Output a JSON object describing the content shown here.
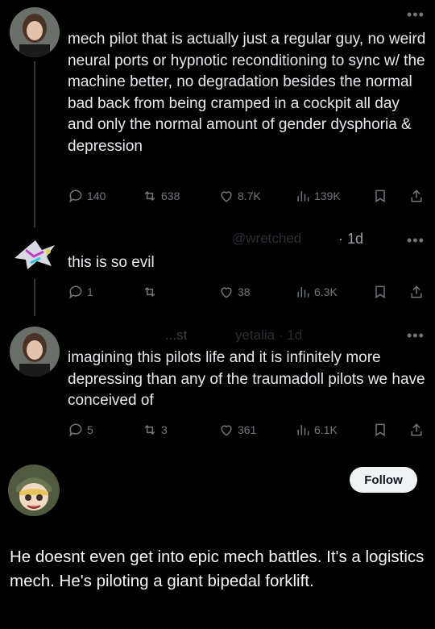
{
  "tweets": [
    {
      "text": "mech pilot that is actually just a regular guy, no weird neural ports or hypnotic reconditioning to sync w/ the machine better, no degradation besides the normal bad back from being cramped in a cockpit all day and only the normal amount of gender dysphoria & depression",
      "more": "•••",
      "replies": "140",
      "reposts": "638",
      "likes": "8.7K",
      "views": "139K"
    },
    {
      "handle": "@wretched",
      "time": "· 1d",
      "text": "this is so evil",
      "more": "•••",
      "replies": "1",
      "reposts": "",
      "likes": "38",
      "views": "6.3K"
    },
    {
      "name_fragment": "...st",
      "handle": "yetalia · 1d",
      "text": "imagining this pilots life and it is infinitely more depressing than any of the traumadoll pilots we have conceived of",
      "more": "•••",
      "replies": "5",
      "reposts": "3",
      "likes": "361",
      "views": "6.1K"
    }
  ],
  "follow_label": "Follow",
  "caption": "He doesnt even get into epic mech battles. It's a logistics mech. He's piloting a giant bipedal forklift.",
  "colors": {
    "background": "#000000",
    "text": "#e7e9ea",
    "muted": "#71767b",
    "line": "#333639",
    "button": "#eff3f4"
  }
}
